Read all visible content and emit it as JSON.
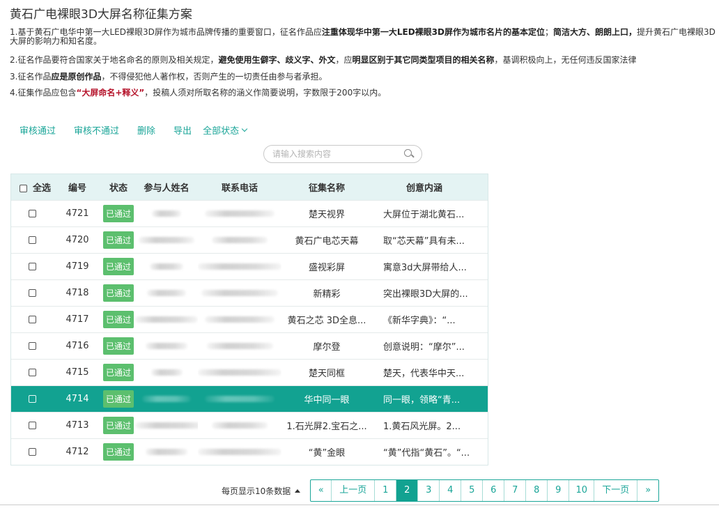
{
  "page": {
    "title": "黄石广电裸眼3D大屏名称征集方案"
  },
  "rules": {
    "r1": {
      "t1": "1.基于黄石广电华中第一大LED裸眼3D屏作为城市品牌传播的重要窗口，征名作品应",
      "b1": "注重体现华中第一大LED裸眼3D屏作为城市名片的基本定位",
      "t2": "；",
      "b2": "简洁大方、朗朗上口，",
      "t3": "提升黄石广电裸眼3D大屏的影响力和知名度。"
    },
    "r2": {
      "t1": "2.征名作品要符合国家关于地名命名的原则及相关规定，",
      "b1": "避免使用生僻字、歧义字、外文",
      "t2": "，应",
      "b2": "明显区别于其它同类型项目的相关名称",
      "t3": "，基调积极向上，无任何违反国家法律"
    },
    "r3": {
      "t1": "3.征名作品",
      "b1": "应是原创作品",
      "t2": "，不得侵犯他人著作权，否则产生的一切责任由参与者承担。"
    },
    "r4": {
      "t1": "4.征集作品应包含",
      "red": "“大屏命名+释义”",
      "t2": "，投稿人须对所取名称的涵义作简要说明，字数限于200字以内。"
    }
  },
  "toolbar": {
    "approve": "审核通过",
    "reject": "审核不通过",
    "delete": "删除",
    "export": "导出",
    "filter": "全部状态"
  },
  "search": {
    "placeholder": "请输入搜索内容"
  },
  "table": {
    "headers": {
      "select_all": "全选",
      "id": "编号",
      "status": "状态",
      "name": "参与人姓名",
      "phone": "联系电话",
      "title": "征集名称",
      "idea": "创意内涵"
    },
    "rows": [
      {
        "id": "4721",
        "status": "已通过",
        "title": "楚天视界",
        "idea": "大屏位于湖北黄石..."
      },
      {
        "id": "4720",
        "status": "已通过",
        "title": "黄石广电芯天幕",
        "idea": "取“芯天幕”具有未..."
      },
      {
        "id": "4719",
        "status": "已通过",
        "title": "盛视彩屏",
        "idea": "寓意3d大屏带给人..."
      },
      {
        "id": "4718",
        "status": "已通过",
        "title": "新精彩",
        "idea": "突出裸眼3D大屏的..."
      },
      {
        "id": "4717",
        "status": "已通过",
        "title": "黄石之芯 3D全息...",
        "idea": "《新华字典》：“..."
      },
      {
        "id": "4716",
        "status": "已通过",
        "title": "摩尔登",
        "idea": "创意说明：“摩尔”..."
      },
      {
        "id": "4715",
        "status": "已通过",
        "title": "楚天同框",
        "idea": "楚天，代表华中天..."
      },
      {
        "id": "4714",
        "status": "已通过",
        "title": "华中同一眼",
        "idea": "同一眼，领略“青..."
      },
      {
        "id": "4713",
        "status": "已通过",
        "title": "1.石光屏2.宝石之...",
        "idea": "1.黄石风光屏。2..."
      },
      {
        "id": "4712",
        "status": "已通过",
        "title": "“黄”金眼",
        "idea": "“黄”代指“黄石”。“..."
      }
    ]
  },
  "pager": {
    "per_page": "每页显示10条数据",
    "first": "«",
    "prev": "上一页",
    "pages": [
      "1",
      "2",
      "3",
      "4",
      "5",
      "6",
      "7",
      "8",
      "9",
      "10"
    ],
    "current": "2",
    "next": "下一页",
    "last": "»"
  },
  "colors": {
    "accent": "#1aa598",
    "selected_row": "#12a291",
    "status_badge": "#5cbf6e",
    "header_bg": "#e4f3f3"
  }
}
